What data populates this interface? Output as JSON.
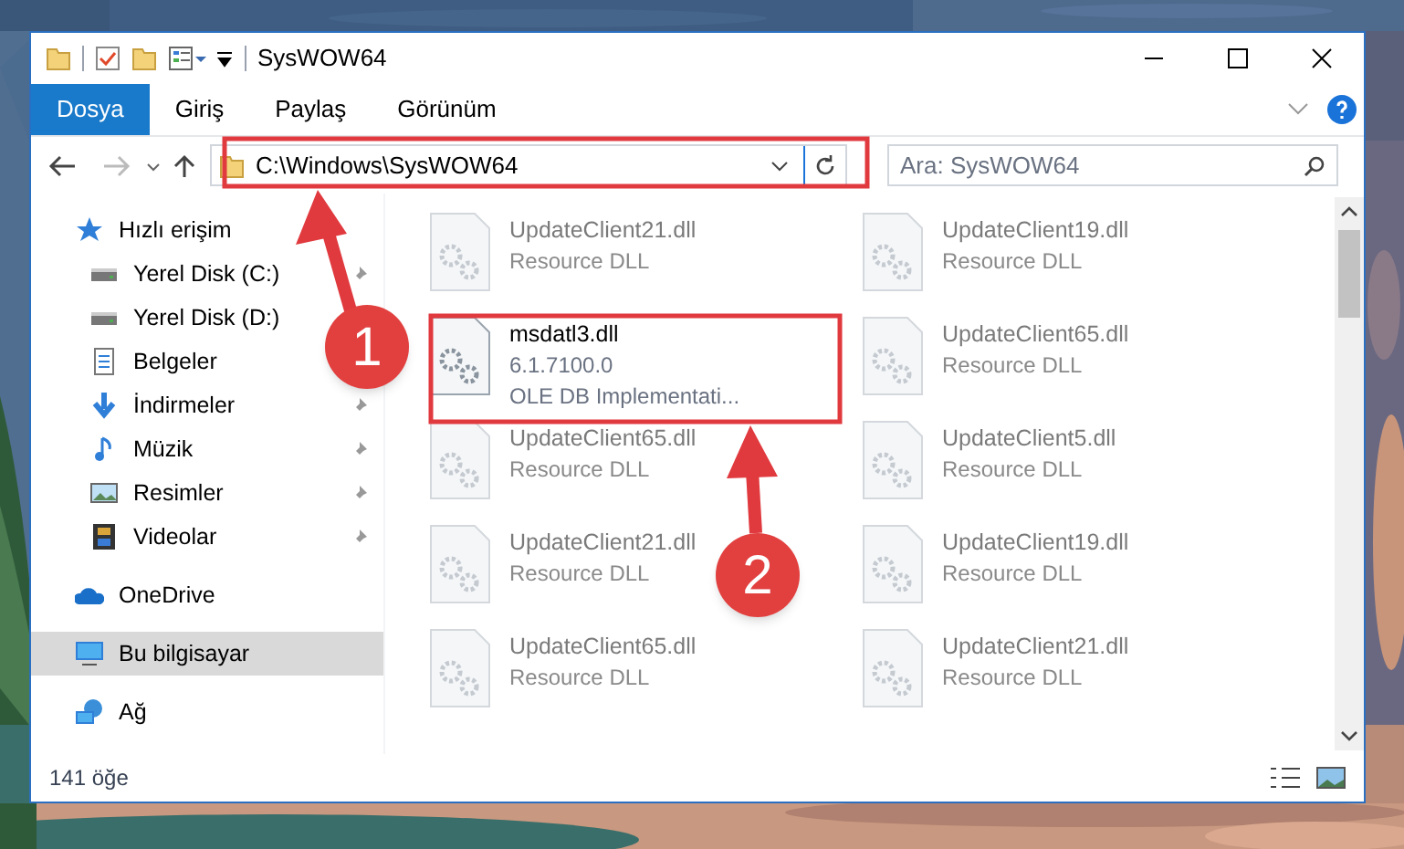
{
  "window": {
    "title": "SysWOW64"
  },
  "ribbon_tabs": [
    {
      "label": "Dosya",
      "selected": true
    },
    {
      "label": "Giriş",
      "selected": false
    },
    {
      "label": "Paylaş",
      "selected": false
    },
    {
      "label": "Görünüm",
      "selected": false
    }
  ],
  "address_bar": {
    "path": "C:\\Windows\\SysWOW64"
  },
  "search": {
    "placeholder": "Ara: SysWOW64"
  },
  "sidebar": {
    "items": [
      {
        "label": "Hızlı erişim",
        "kind": "quick",
        "selected": false,
        "children": [
          {
            "label": "Yerel Disk (C:)",
            "kind": "drive",
            "pinned": true,
            "selected": false
          },
          {
            "label": "Yerel Disk (D:)",
            "kind": "drive",
            "pinned": false,
            "selected": false
          },
          {
            "label": "Belgeler",
            "kind": "docs",
            "pinned": false,
            "selected": false
          },
          {
            "label": "İndirmeler",
            "kind": "download",
            "pinned": true,
            "selected": false
          },
          {
            "label": "Müzik",
            "kind": "music",
            "pinned": true,
            "selected": false
          },
          {
            "label": "Resimler",
            "kind": "pictures",
            "pinned": true,
            "selected": false
          },
          {
            "label": "Videolar",
            "kind": "video",
            "pinned": true,
            "selected": false
          }
        ]
      },
      {
        "label": "OneDrive",
        "kind": "cloud",
        "selected": false
      },
      {
        "label": "Bu bilgisayar",
        "kind": "pc",
        "selected": true
      },
      {
        "label": "Ağ",
        "kind": "network",
        "selected": false
      }
    ]
  },
  "files": [
    {
      "name": "UpdateClient21.dll",
      "details": [
        "Resource DLL"
      ],
      "dimmed": true
    },
    {
      "name": "UpdateClient19.dll",
      "details": [
        "Resource DLL"
      ],
      "dimmed": true
    },
    {
      "name": "msdatl3.dll",
      "details": [
        "6.1.7100.0",
        "OLE DB Implementati..."
      ],
      "dimmed": false
    },
    {
      "name": "UpdateClient65.dll",
      "details": [
        "Resource DLL"
      ],
      "dimmed": true
    },
    {
      "name": "UpdateClient65.dll",
      "details": [
        "Resource DLL"
      ],
      "dimmed": true
    },
    {
      "name": "UpdateClient5.dll",
      "details": [
        "Resource DLL"
      ],
      "dimmed": true
    },
    {
      "name": "UpdateClient21.dll",
      "details": [
        "Resource DLL"
      ],
      "dimmed": true
    },
    {
      "name": "UpdateClient19.dll",
      "details": [
        "Resource DLL"
      ],
      "dimmed": true
    },
    {
      "name": "UpdateClient65.dll",
      "details": [
        "Resource DLL"
      ],
      "dimmed": true
    },
    {
      "name": "UpdateClient21.dll",
      "details": [
        "Resource DLL"
      ],
      "dimmed": true
    }
  ],
  "status_bar": {
    "count": "141 öğe"
  },
  "annotations": [
    {
      "label": "1"
    },
    {
      "label": "2"
    }
  ]
}
